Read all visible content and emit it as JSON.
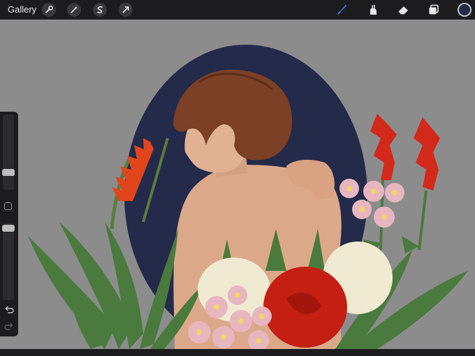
{
  "topbar": {
    "gallery_label": "Gallery",
    "left_tools": [
      {
        "name": "actions-wrench-icon"
      },
      {
        "name": "adjustments-magic-wand-icon"
      },
      {
        "name": "selection-s-icon"
      },
      {
        "name": "transform-arrow-icon"
      }
    ],
    "right_tools": [
      {
        "name": "brush-icon",
        "active": true
      },
      {
        "name": "smudge-icon",
        "active": false
      },
      {
        "name": "eraser-icon",
        "active": false
      },
      {
        "name": "layers-icon",
        "active": false
      }
    ],
    "current_color": "#242a4a"
  },
  "sidebar": {
    "brush_size_level": 0.2,
    "opacity_level": 0.98,
    "buttons": [
      "undo-icon",
      "redo-icon"
    ]
  },
  "colors": {
    "canvas_background": "#8c8c8c",
    "oval": "#242a4a",
    "accent_blue": "#2f7ff0",
    "carnation_red": "#c41f12",
    "carnation_white": "#f1ead3",
    "rose_pink": "#e8b6c0",
    "leaf_green": "#4a7a3e",
    "hair_brown": "#7b4025",
    "skin": "#dba98a"
  }
}
